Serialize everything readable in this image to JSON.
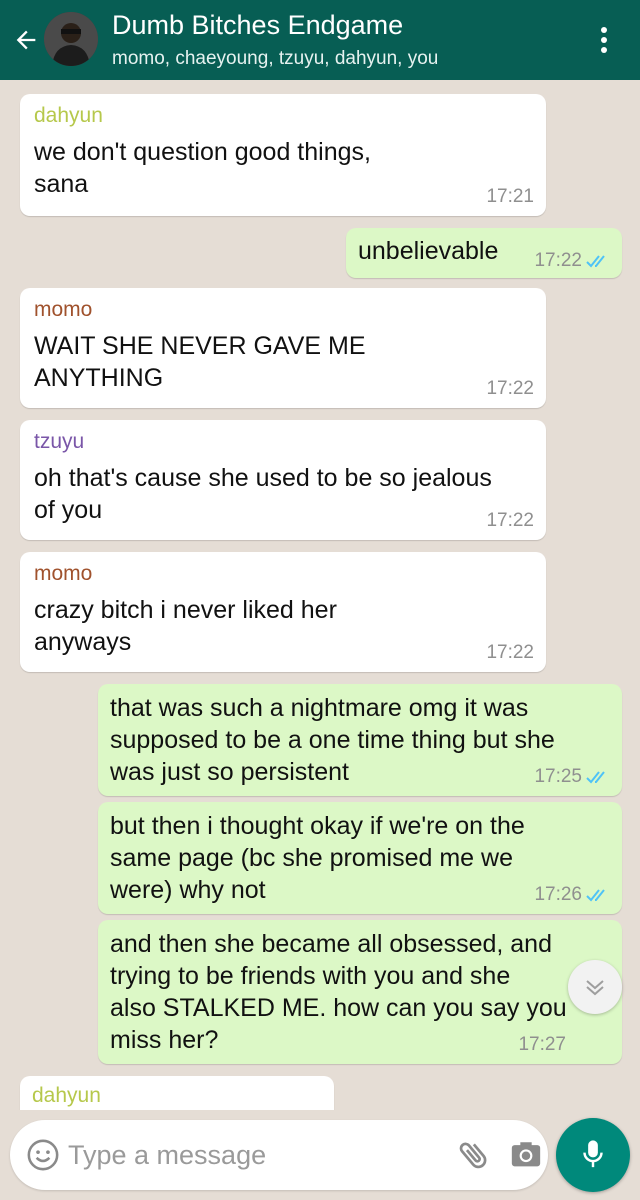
{
  "header": {
    "title": "Dumb Bitches Endgame",
    "subtitle": "momo, chaeyoung, tzuyu, dahyun, you",
    "icons": [
      "back-arrow-icon",
      "more-options-icon"
    ]
  },
  "colors": {
    "header_bg": "#075e54",
    "outgoing_bubble": "#dcf8c6",
    "incoming_bubble": "#ffffff",
    "read_ticks": "#4fc3f7",
    "dahyun": "#b6c84b",
    "momo": "#a0522d",
    "tzuyu": "#7a56a8",
    "mic_button": "#00897b"
  },
  "messages": [
    {
      "sender": "dahyun",
      "text_lines": [
        "we don't question good things,",
        "sana"
      ],
      "time": "17:21"
    },
    {
      "sender": "",
      "text_lines": [
        "unbelievable"
      ],
      "time": "17:22"
    },
    {
      "sender": "momo",
      "text_lines": [
        "WAIT SHE NEVER GAVE ME",
        "ANYTHING"
      ],
      "time": "17:22"
    },
    {
      "sender": "tzuyu",
      "text_lines": [
        "oh that's cause she used to be so jealous",
        "of you"
      ],
      "time": "17:22"
    },
    {
      "sender": "momo",
      "text_lines": [
        "crazy bitch i never liked her",
        "anyways"
      ],
      "time": "17:22"
    },
    {
      "sender": "",
      "text_lines": [
        "that was such a nightmare omg it was",
        "supposed to be a one time thing but she",
        "was just so persistent"
      ],
      "time": "17:25"
    },
    {
      "sender": "",
      "text_lines": [
        "but then i thought okay if we're on the",
        "same page (bc she promised me we",
        "were) why not"
      ],
      "time": "17:26"
    },
    {
      "sender": "",
      "text_lines": [
        "and then she became all obsessed, and",
        "trying to be friends with you and she",
        "also STALKED ME. how can you say you",
        "miss her?"
      ],
      "time": "17:27"
    },
    {
      "sender": "dahyun",
      "text_lines": [],
      "time": ""
    }
  ],
  "composer": {
    "placeholder": "Type a message",
    "icons": [
      "emoji-icon",
      "attach-icon",
      "camera-icon",
      "mic-icon",
      "scroll-down-icon"
    ]
  }
}
